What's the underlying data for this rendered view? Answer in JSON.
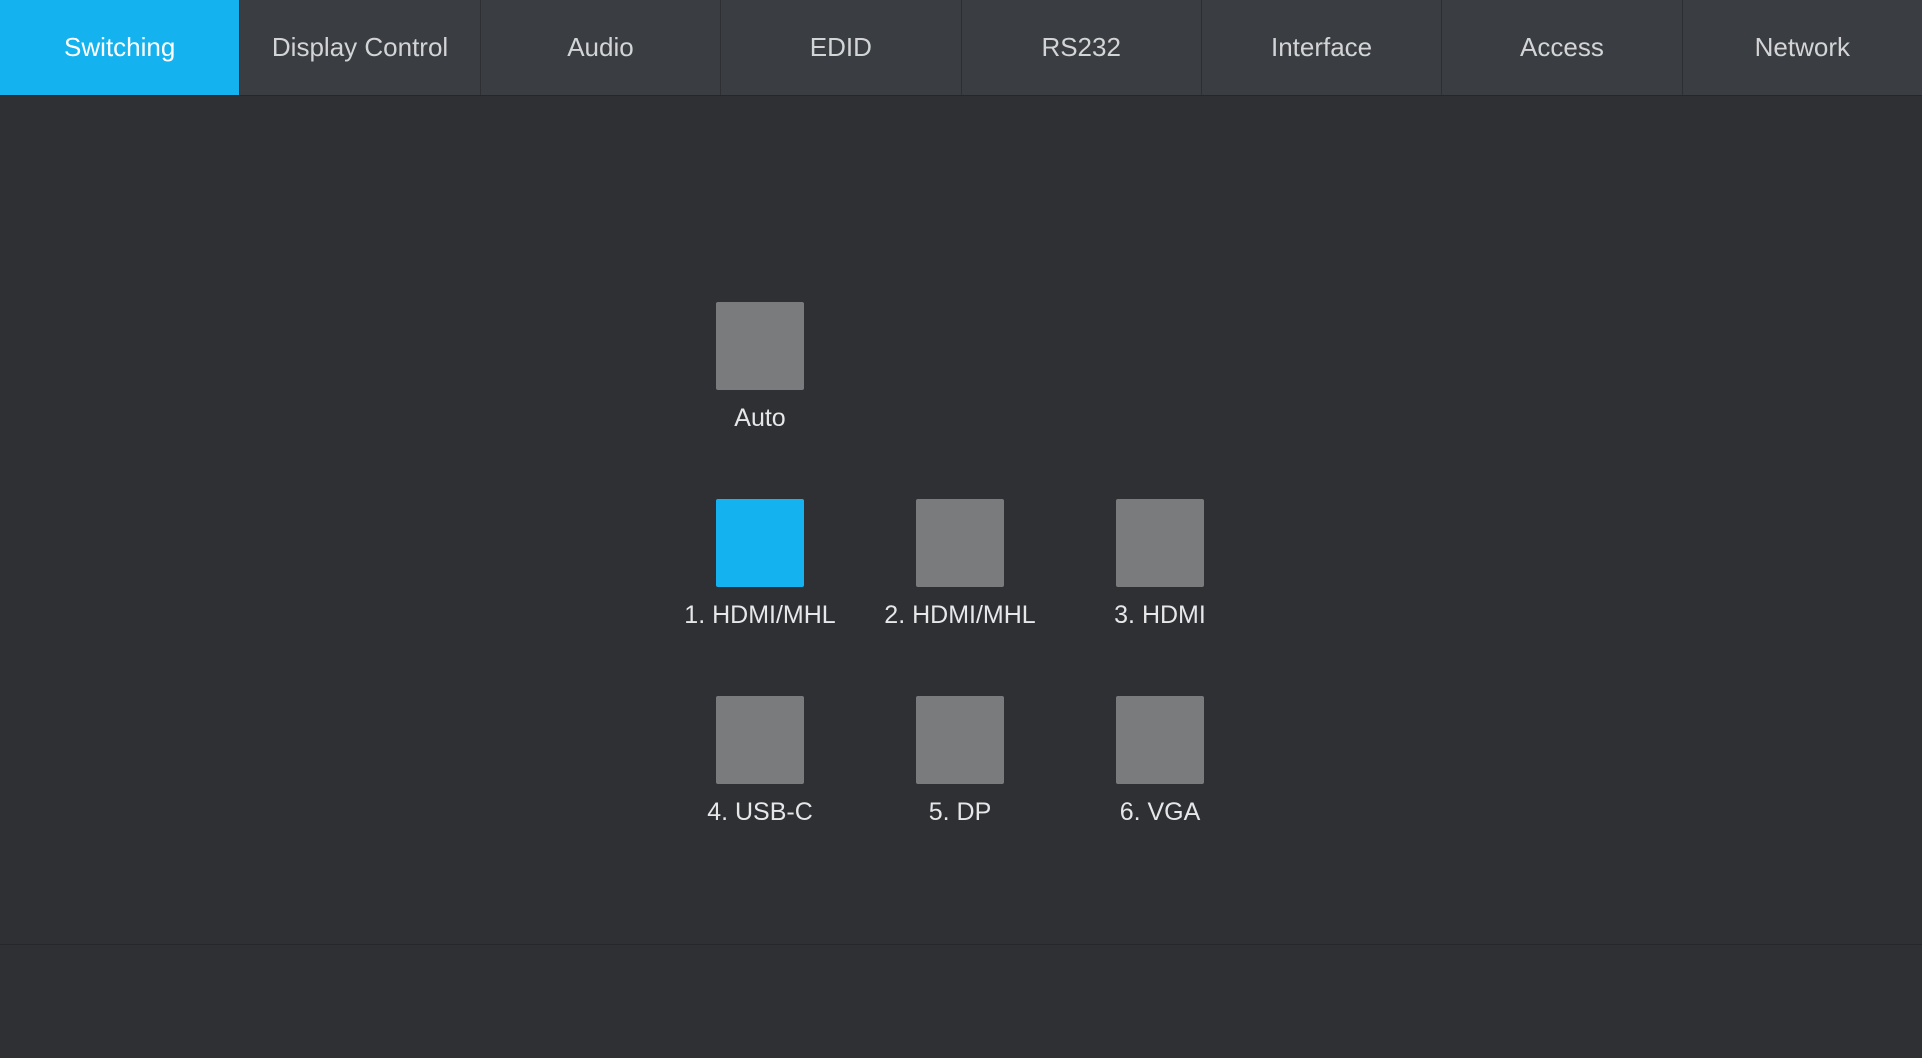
{
  "tabs": [
    {
      "label": "Switching",
      "active": true
    },
    {
      "label": "Display Control",
      "active": false
    },
    {
      "label": "Audio",
      "active": false
    },
    {
      "label": "EDID",
      "active": false
    },
    {
      "label": "RS232",
      "active": false
    },
    {
      "label": "Interface",
      "active": false
    },
    {
      "label": "Access",
      "active": false
    },
    {
      "label": "Network",
      "active": false
    }
  ],
  "switching": {
    "auto": {
      "label": "Auto",
      "active": false
    },
    "inputs": [
      {
        "label": "1. HDMI/MHL",
        "active": true
      },
      {
        "label": "2. HDMI/MHL",
        "active": false
      },
      {
        "label": "3. HDMI",
        "active": false
      },
      {
        "label": "4. USB-C",
        "active": false
      },
      {
        "label": "5. DP",
        "active": false
      },
      {
        "label": "6. VGA",
        "active": false
      }
    ]
  }
}
